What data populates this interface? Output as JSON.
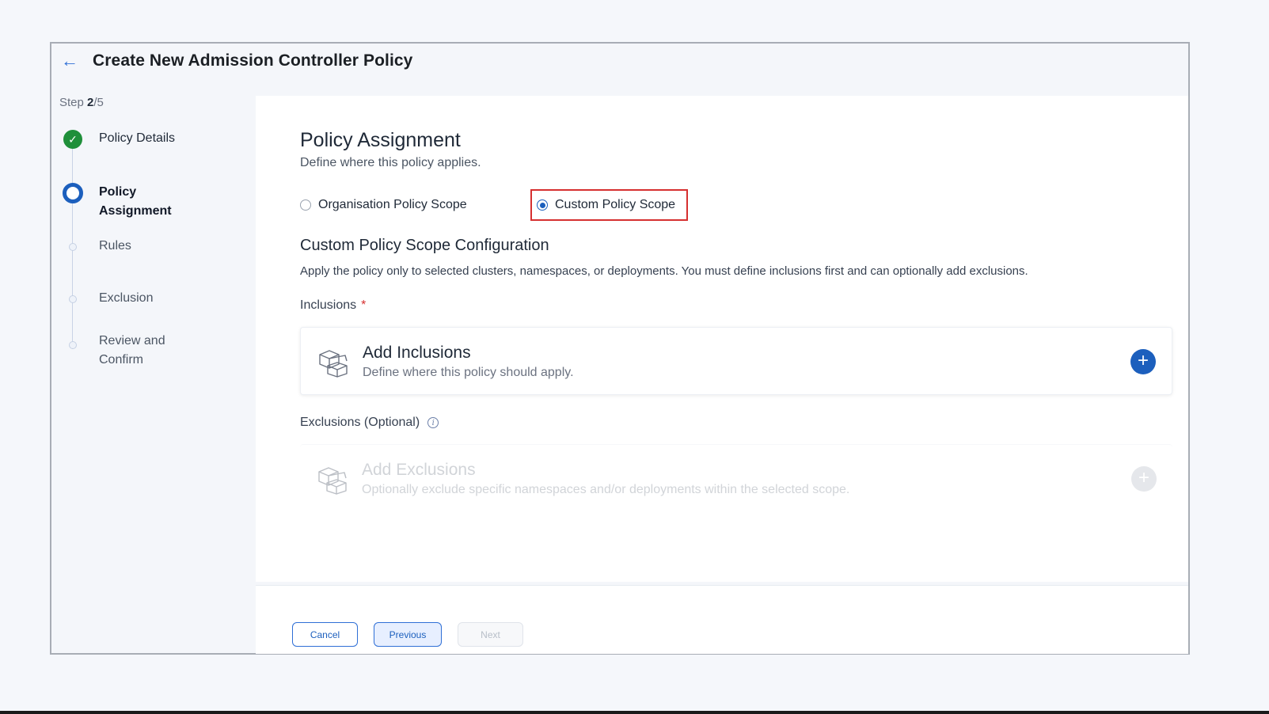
{
  "header": {
    "back_icon": "arrow-left-icon",
    "title": "Create New Admission Controller Policy"
  },
  "sidebar": {
    "step_prefix": "Step ",
    "step_current": "2",
    "step_total": "/5",
    "steps": [
      {
        "label": "Policy Details",
        "status": "complete",
        "icon": "check-icon"
      },
      {
        "label": "Policy Assignment",
        "status": "active"
      },
      {
        "label": "Rules",
        "status": "pending"
      },
      {
        "label": "Exclusion",
        "status": "pending"
      },
      {
        "label": "Review and Confirm",
        "status": "pending"
      }
    ]
  },
  "main": {
    "title": "Policy Assignment",
    "description": "Define where this policy applies.",
    "scope_options": [
      {
        "label": "Organisation Policy Scope",
        "selected": false
      },
      {
        "label": "Custom Policy Scope",
        "selected": true
      }
    ],
    "config_title": "Custom Policy Scope Configuration",
    "config_description": "Apply the policy only to selected clusters, namespaces, or deployments. You must define inclusions first and can optionally add exclusions.",
    "inclusions": {
      "label": "Inclusions",
      "required_mark": "*",
      "card_title": "Add Inclusions",
      "card_description": "Define where this policy should apply.",
      "icon": "boxes-icon",
      "add_icon": "plus-icon"
    },
    "exclusions": {
      "label": "Exclusions (Optional)",
      "info_icon": "info-icon",
      "card_title": "Add Exclusions",
      "card_description": "Optionally exclude specific namespaces and/or deployments within the selected scope.",
      "icon": "boxes-icon",
      "add_icon": "plus-icon",
      "enabled": false
    }
  },
  "footer": {
    "cancel_label": "Cancel",
    "previous_label": "Previous",
    "next_label": "Next",
    "next_enabled": false
  },
  "colors": {
    "primary": "#1c5fbd",
    "success": "#1f8f3a",
    "highlight_border": "#d63030"
  }
}
